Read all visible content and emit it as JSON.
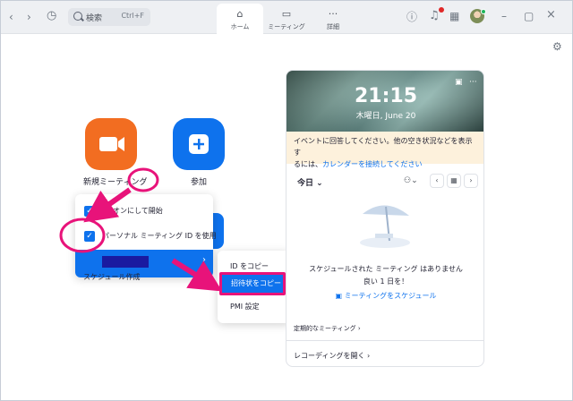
{
  "search": {
    "label": "検索",
    "shortcut": "Ctrl+F"
  },
  "nav": {
    "tabs": [
      {
        "label": "ホーム",
        "icon": "home-icon"
      },
      {
        "label": "ミーティング",
        "icon": "video-icon"
      },
      {
        "label": "詳細",
        "icon": "more-icon"
      }
    ]
  },
  "home": {
    "new_meeting_label": "新規ミーティング",
    "join_label": "参加",
    "schedule_label_partial": "スケジュール作成"
  },
  "meeting_menu": {
    "items": [
      {
        "label": "ビデオをオンにして開始",
        "visible_part": "オンにして開始",
        "checked": true
      },
      {
        "label": "パーソナル ミーティング ID を使用",
        "visible_part": "パーソナル ミーティング ID を使用",
        "checked": true
      }
    ]
  },
  "submenu": {
    "copy_id": "ID をコピー",
    "copy_invite": "招待状をコピー",
    "pmi_settings": "PMI 設定"
  },
  "calendar": {
    "time": "21:15",
    "date": "木曜日, June 20",
    "notice_line1": "イベントに回答してください。他の空き状況などを表示す",
    "notice_line2_prefix": "るには、",
    "notice_link": "カレンダーを接続してください",
    "today_label": "今日",
    "empty_line1": "スケジュールされた ミーティング はありません",
    "empty_line2": "良い 1 日を！",
    "schedule_link": "ミーティングをスケジュール",
    "recurring": "定期的なミーティング",
    "recordings": "レコーディングを開く"
  },
  "colors": {
    "accent": "#0e72ed",
    "orange": "#f26d21",
    "annotation": "#e8137a",
    "redaction": "#1a1aa0"
  }
}
